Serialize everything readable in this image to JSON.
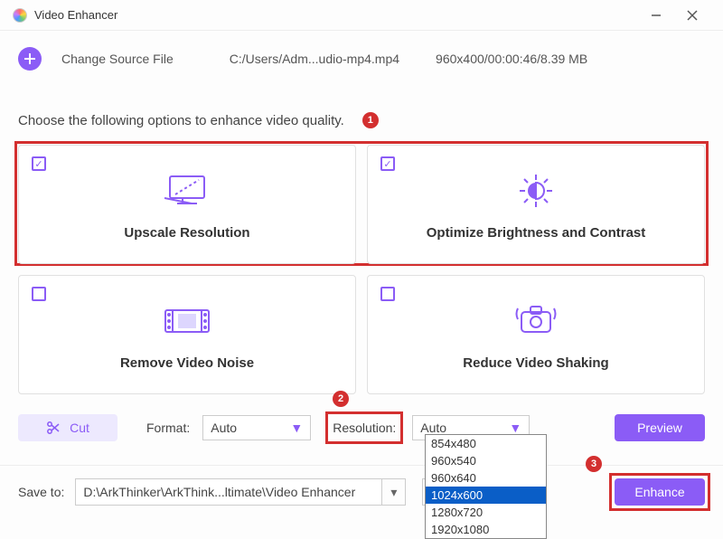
{
  "window": {
    "title": "Video Enhancer"
  },
  "source": {
    "change_label": "Change Source File",
    "path": "C:/Users/Adm...udio-mp4.mp4",
    "meta": "960x400/00:00:46/8.39 MB"
  },
  "instruction": "Choose the following options to enhance video quality.",
  "steps": {
    "one": "1",
    "two": "2",
    "three": "3"
  },
  "options": {
    "upscale": {
      "label": "Upscale Resolution",
      "checked": true
    },
    "optimize": {
      "label": "Optimize Brightness and Contrast",
      "checked": true
    },
    "noise": {
      "label": "Remove Video Noise",
      "checked": false
    },
    "shaking": {
      "label": "Reduce Video Shaking",
      "checked": false
    }
  },
  "toolbar": {
    "cut_label": "Cut",
    "format_label": "Format:",
    "format_value": "Auto",
    "resolution_label": "Resolution:",
    "resolution_value": "Auto",
    "preview_label": "Preview"
  },
  "resolution_options": [
    "854x480",
    "960x540",
    "960x640",
    "1024x600",
    "1280x720",
    "1920x1080"
  ],
  "resolution_selected": "1024x600",
  "save": {
    "label": "Save to:",
    "path": "D:\\ArkThinker\\ArkThink...ltimate\\Video Enhancer",
    "enhance_label": "Enhance"
  }
}
